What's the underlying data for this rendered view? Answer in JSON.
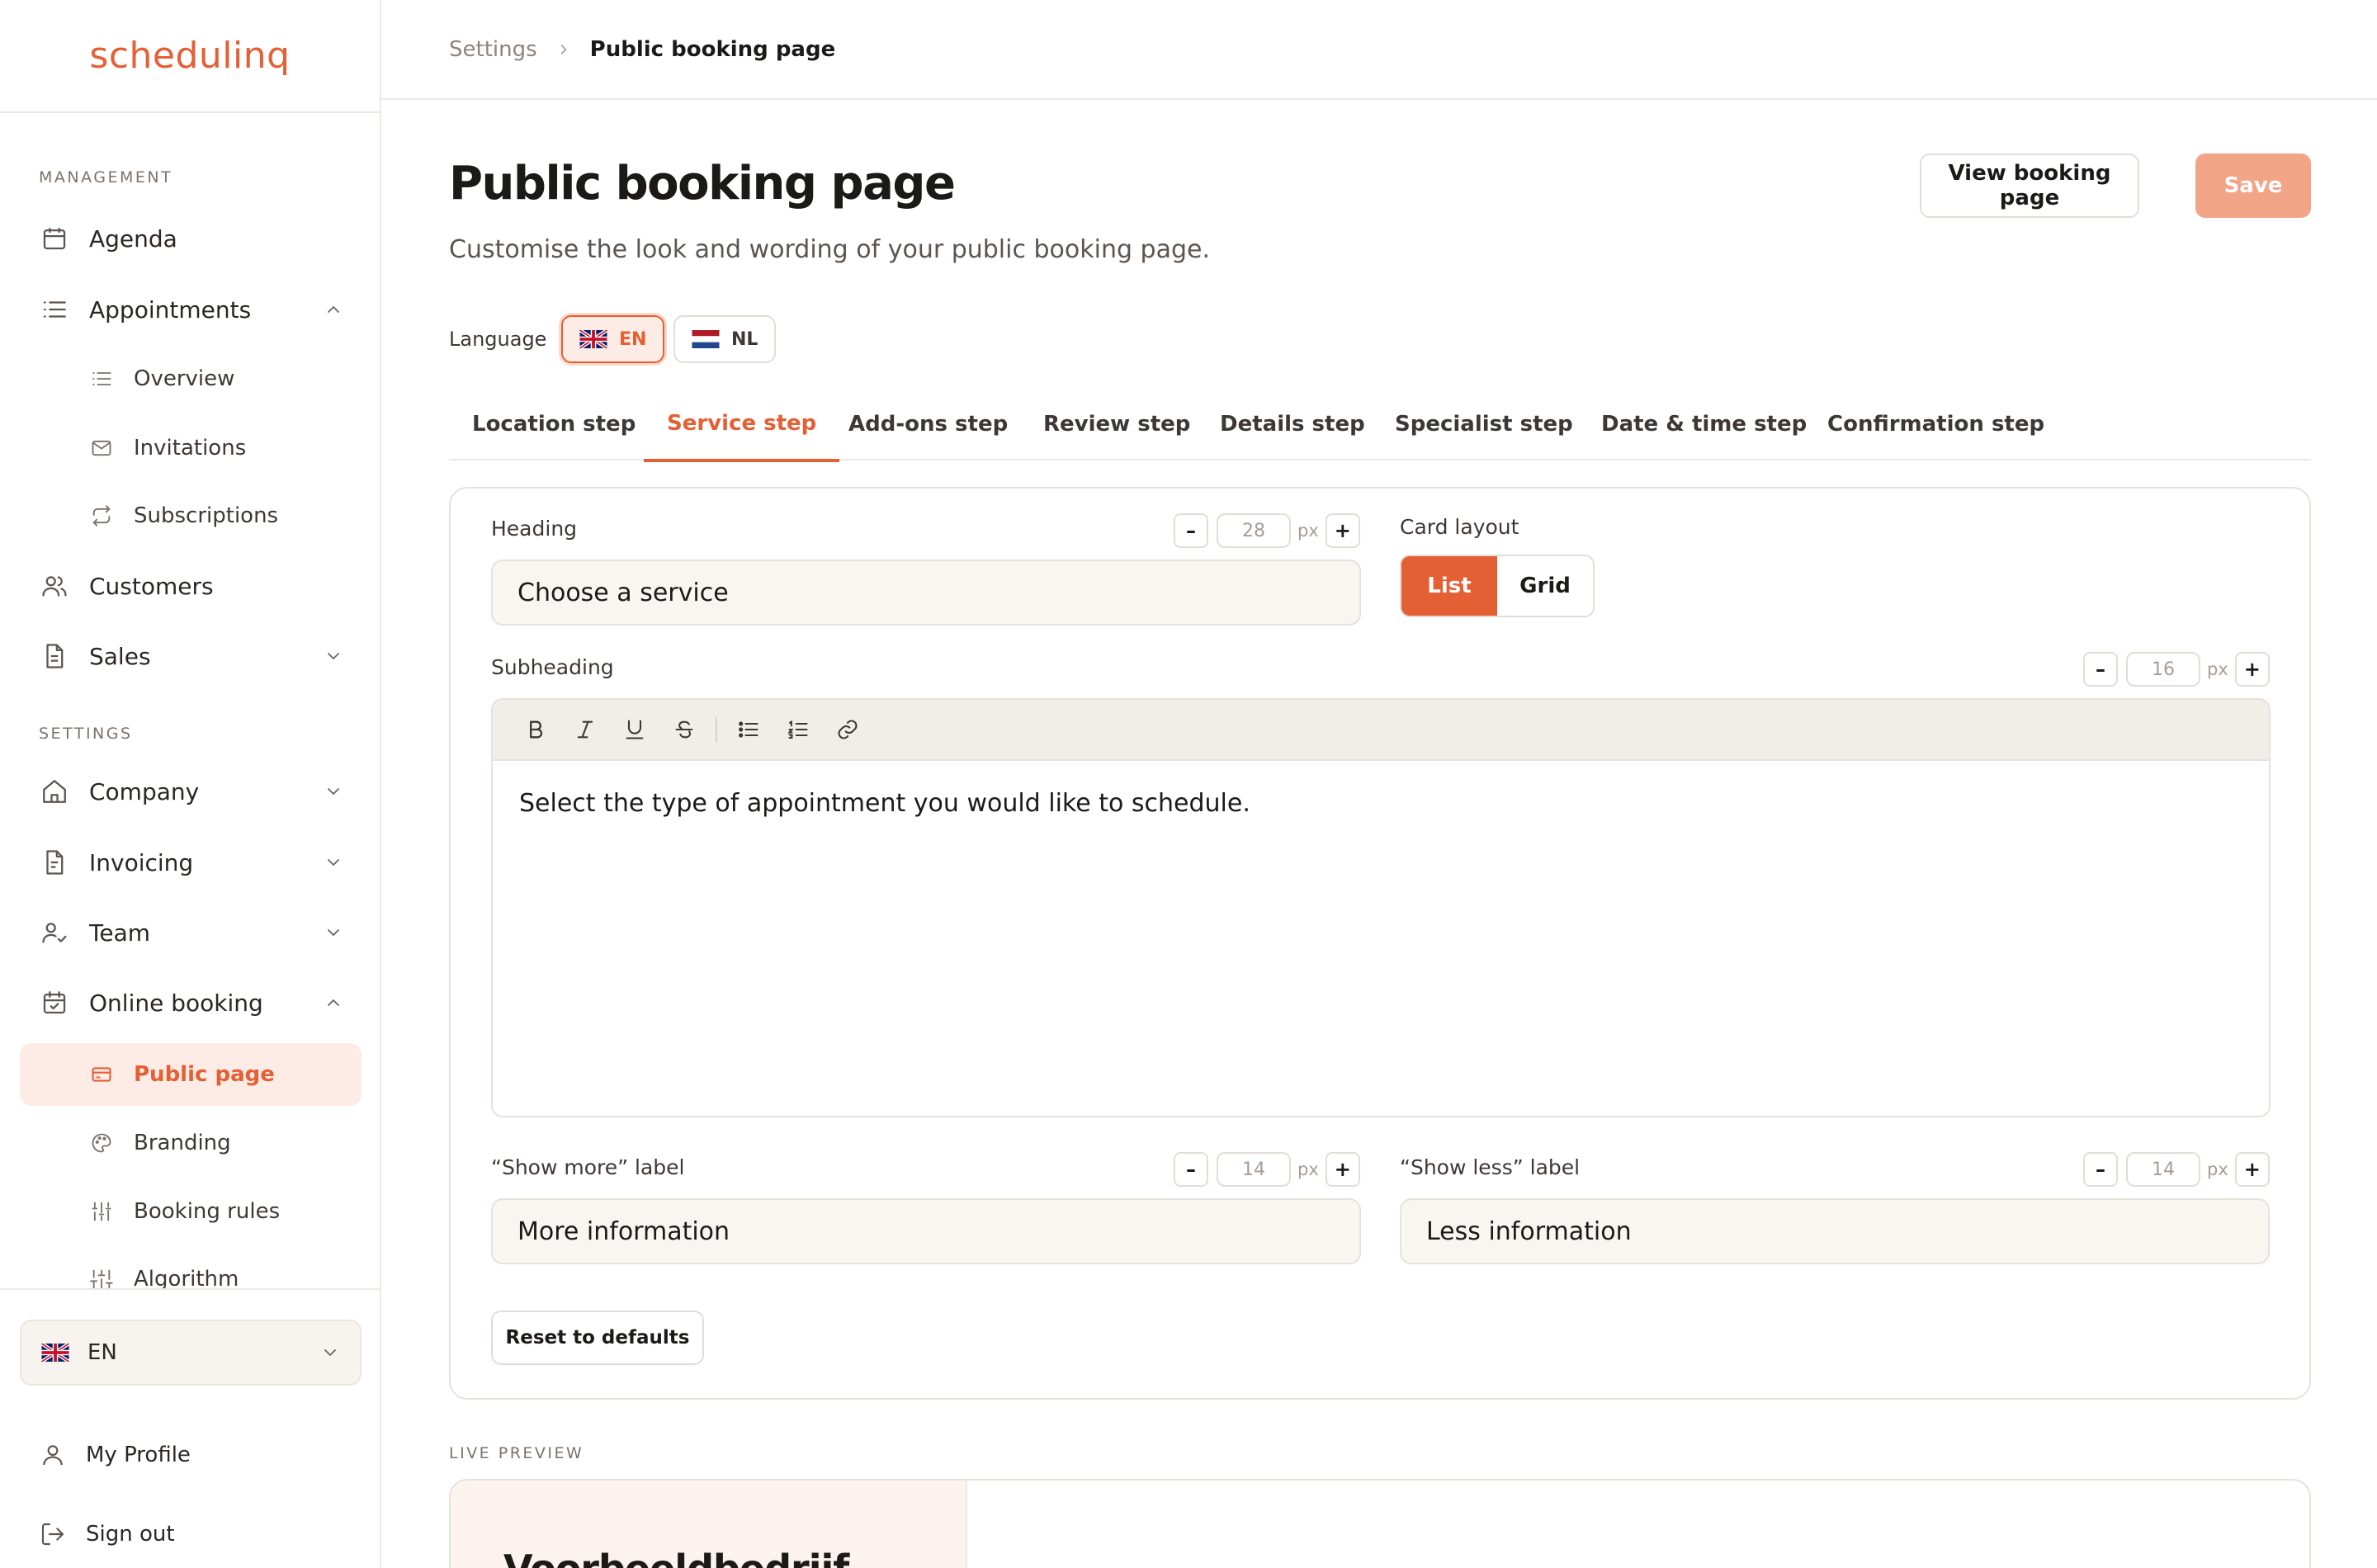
{
  "app": {
    "logo": "schedulinq"
  },
  "sidebar": {
    "sections": {
      "management": "MANAGEMENT",
      "settings": "SETTINGS"
    },
    "items": {
      "agenda": "Agenda",
      "appointments": "Appointments",
      "overview": "Overview",
      "invitations": "Invitations",
      "subscriptions": "Subscriptions",
      "customers": "Customers",
      "sales": "Sales",
      "company": "Company",
      "invoicing": "Invoicing",
      "team": "Team",
      "online_booking": "Online booking",
      "public_page": "Public page",
      "branding": "Branding",
      "booking_rules": "Booking rules",
      "algorithm": "Algorithm"
    },
    "language": "EN",
    "my_profile": "My Profile",
    "sign_out": "Sign out"
  },
  "breadcrumb": {
    "parent": "Settings",
    "current": "Public booking page"
  },
  "page": {
    "title": "Public booking page",
    "subtitle": "Customise the look and wording of your public booking page.",
    "view_button": "View booking page",
    "save_button": "Save"
  },
  "language_switch": {
    "label": "Language",
    "options": [
      "EN",
      "NL"
    ],
    "selected": "EN"
  },
  "tabs": [
    "Location step",
    "Service step",
    "Add-ons step",
    "Review step",
    "Details step",
    "Specialist step",
    "Date & time step",
    "Confirmation step"
  ],
  "active_tab": "Service step",
  "form": {
    "heading": {
      "label": "Heading",
      "value": "Choose a service",
      "size": "28",
      "unit": "px"
    },
    "card_layout": {
      "label": "Card layout",
      "options": [
        "List",
        "Grid"
      ],
      "selected": "List"
    },
    "subheading": {
      "label": "Subheading",
      "value": "Select the type of appointment you would like to schedule.",
      "size": "16",
      "unit": "px"
    },
    "show_more": {
      "label": "“Show more” label",
      "value": "More information",
      "size": "14",
      "unit": "px"
    },
    "show_less": {
      "label": "“Show less” label",
      "value": "Less information",
      "size": "14",
      "unit": "px"
    },
    "minus": "–",
    "plus": "+",
    "reset_button": "Reset to defaults"
  },
  "preview": {
    "label": "LIVE PREVIEW",
    "company": "Voorbeeldbedrijf"
  },
  "colors": {
    "accent": "#e55f34",
    "accent_soft": "#fdece5",
    "save_disabled": "#f2a487"
  }
}
